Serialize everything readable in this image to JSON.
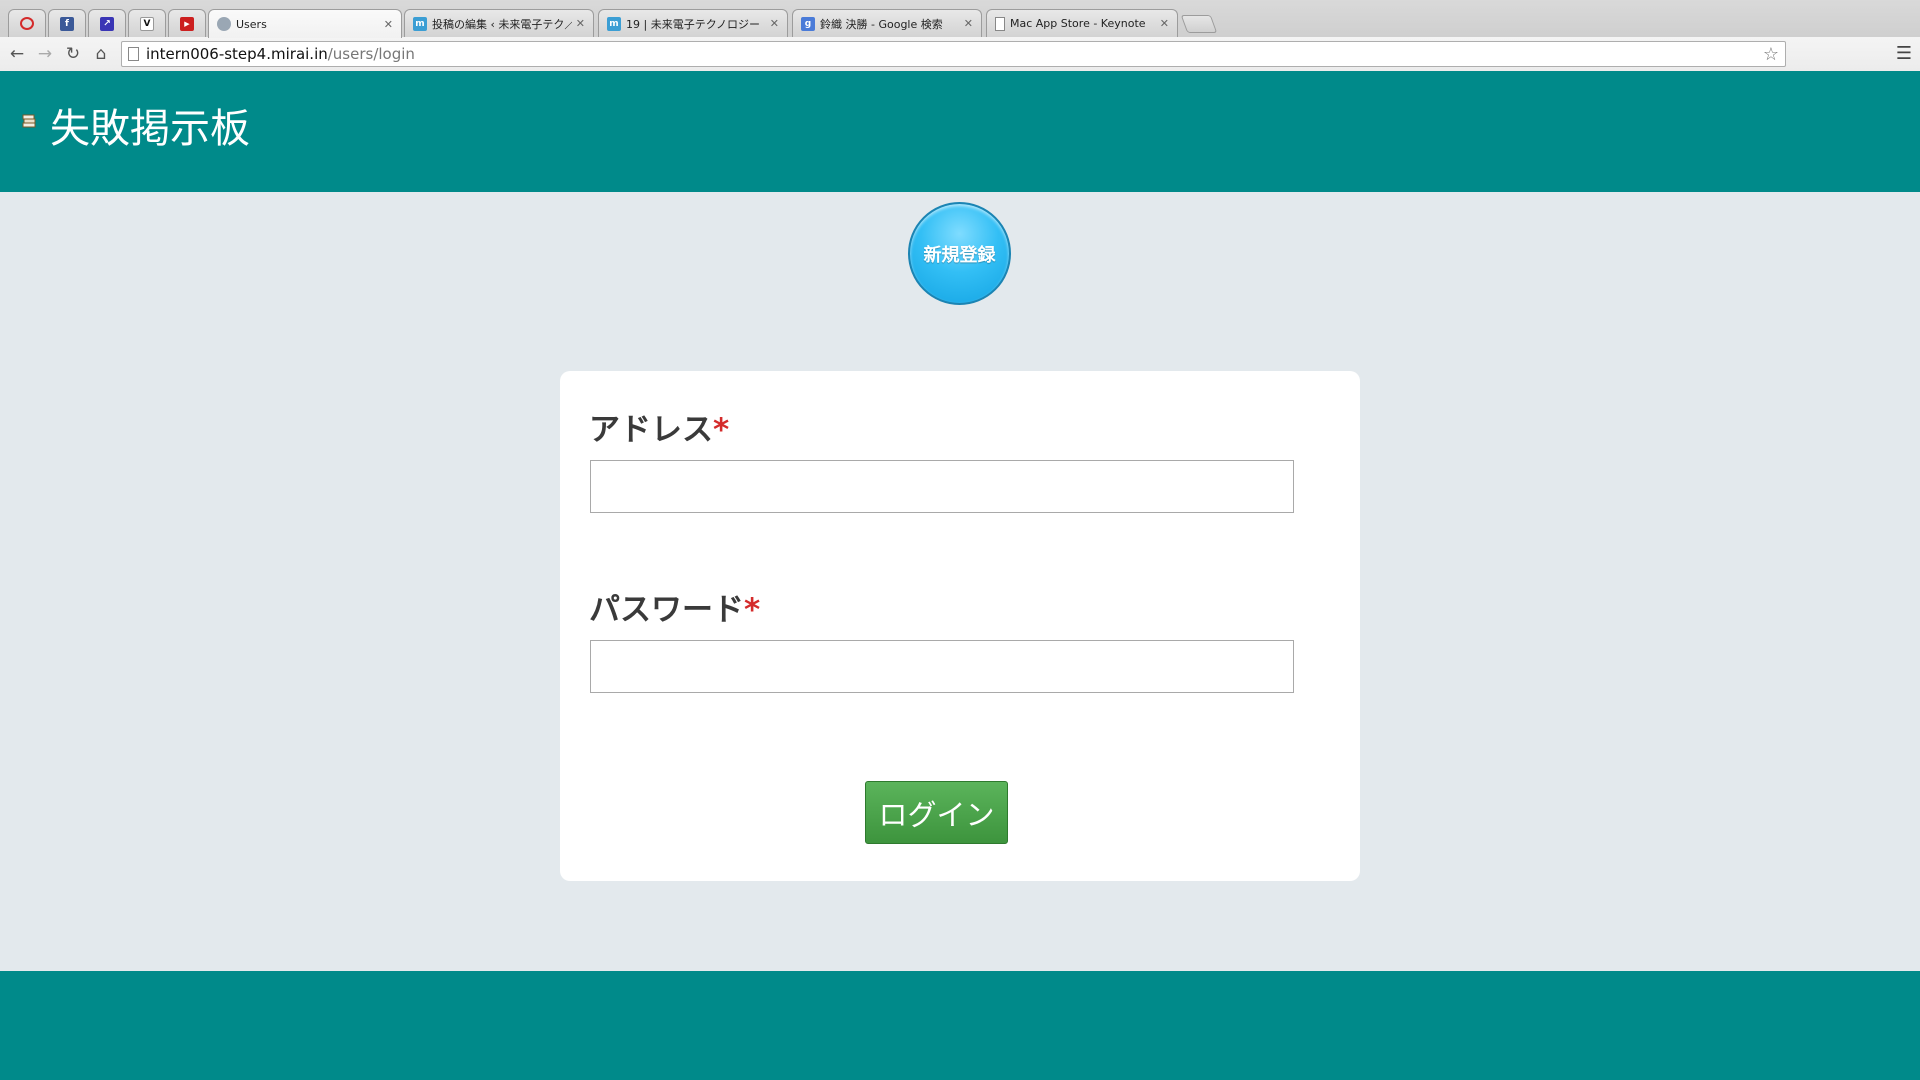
{
  "browser": {
    "tabs": [
      {
        "label": "",
        "icon": "opera-icon",
        "color": "#ffffff",
        "glyph": "O",
        "pinned": true
      },
      {
        "label": "",
        "icon": "facebook-icon",
        "color": "#3b5998",
        "glyph": "f",
        "pinned": true
      },
      {
        "label": "",
        "icon": "bookmark-app-icon",
        "color": "#3a35b5",
        "glyph": "↗",
        "pinned": true
      },
      {
        "label": "",
        "icon": "v-app-icon",
        "color": "#ffffff",
        "glyph": "V",
        "pinned": true
      },
      {
        "label": "",
        "icon": "youtube-icon",
        "color": "#cc1f1f",
        "glyph": "▶",
        "pinned": true
      },
      {
        "label": "Users",
        "icon": "page-globe-icon",
        "color": "#9aa7b4",
        "glyph": "",
        "active": true
      },
      {
        "label": "投稿の編集 ‹ 未来電子テク／",
        "icon": "mirai-icon",
        "color": "#3b9ed4",
        "glyph": "m"
      },
      {
        "label": "19 | 未来電子テクノロジー",
        "icon": "mirai-icon",
        "color": "#3b9ed4",
        "glyph": "m"
      },
      {
        "label": "鈴織 決勝 - Google 検索",
        "icon": "google-icon",
        "color": "#4a7bd8",
        "glyph": "g"
      },
      {
        "label": "Mac App Store - Keynote",
        "icon": "document-icon",
        "color": "#ffffff",
        "glyph": ""
      }
    ],
    "url_host": "intern006-step4.mirai.in",
    "url_path": "/users/login"
  },
  "header": {
    "title": "失敗掲示板"
  },
  "register_button": "新規登録",
  "form": {
    "address_label": "アドレス",
    "password_label": "パスワード",
    "required_mark": "*",
    "address_value": "",
    "password_value": "",
    "submit_label": "ログイン"
  },
  "colors": {
    "brand": "#008a8a",
    "page_bg": "#e3e9ed",
    "register": "#33bff5",
    "submit": "#4aa54a",
    "required": "#d42b2b"
  }
}
